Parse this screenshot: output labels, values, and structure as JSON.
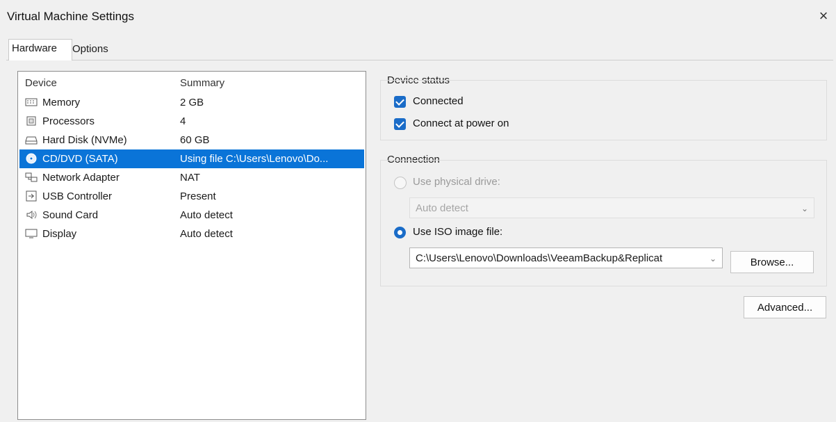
{
  "window": {
    "title": "Virtual Machine Settings",
    "close_glyph": "×"
  },
  "tabs": [
    {
      "label": "Hardware",
      "active": true
    },
    {
      "label": "Options",
      "active": false
    }
  ],
  "device_list": {
    "headers": {
      "device": "Device",
      "summary": "Summary"
    },
    "rows": [
      {
        "device": "Memory",
        "summary": "2 GB",
        "icon": "memory-icon"
      },
      {
        "device": "Processors",
        "summary": "4",
        "icon": "processor-icon"
      },
      {
        "device": "Hard Disk (NVMe)",
        "summary": "60 GB",
        "icon": "hard-disk-icon"
      },
      {
        "device": "CD/DVD (SATA)",
        "summary": "Using file C:\\Users\\Lenovo\\Do...",
        "icon": "cd-dvd-icon",
        "selected": true
      },
      {
        "device": "Network Adapter",
        "summary": "NAT",
        "icon": "network-adapter-icon"
      },
      {
        "device": "USB Controller",
        "summary": "Present",
        "icon": "usb-controller-icon"
      },
      {
        "device": "Sound Card",
        "summary": "Auto detect",
        "icon": "speaker-icon"
      },
      {
        "device": "Display",
        "summary": "Auto detect",
        "icon": "monitor-icon"
      }
    ]
  },
  "device_status": {
    "title": "Device status",
    "connected": {
      "label": "Connected",
      "checked": true
    },
    "connect_at_power_on": {
      "label": "Connect at power on",
      "checked": true
    }
  },
  "connection": {
    "title": "Connection",
    "physical": {
      "label": "Use physical drive:",
      "selected": false,
      "enabled": false,
      "value": "Auto detect"
    },
    "iso": {
      "label": "Use ISO image file:",
      "selected": true,
      "value": "C:\\Users\\Lenovo\\Downloads\\VeeamBackup&Replicat"
    },
    "browse_label": "Browse..."
  },
  "advanced_label": "Advanced...",
  "colors": {
    "selection": "#0a74d8",
    "checkbox": "#1a6cc8"
  }
}
